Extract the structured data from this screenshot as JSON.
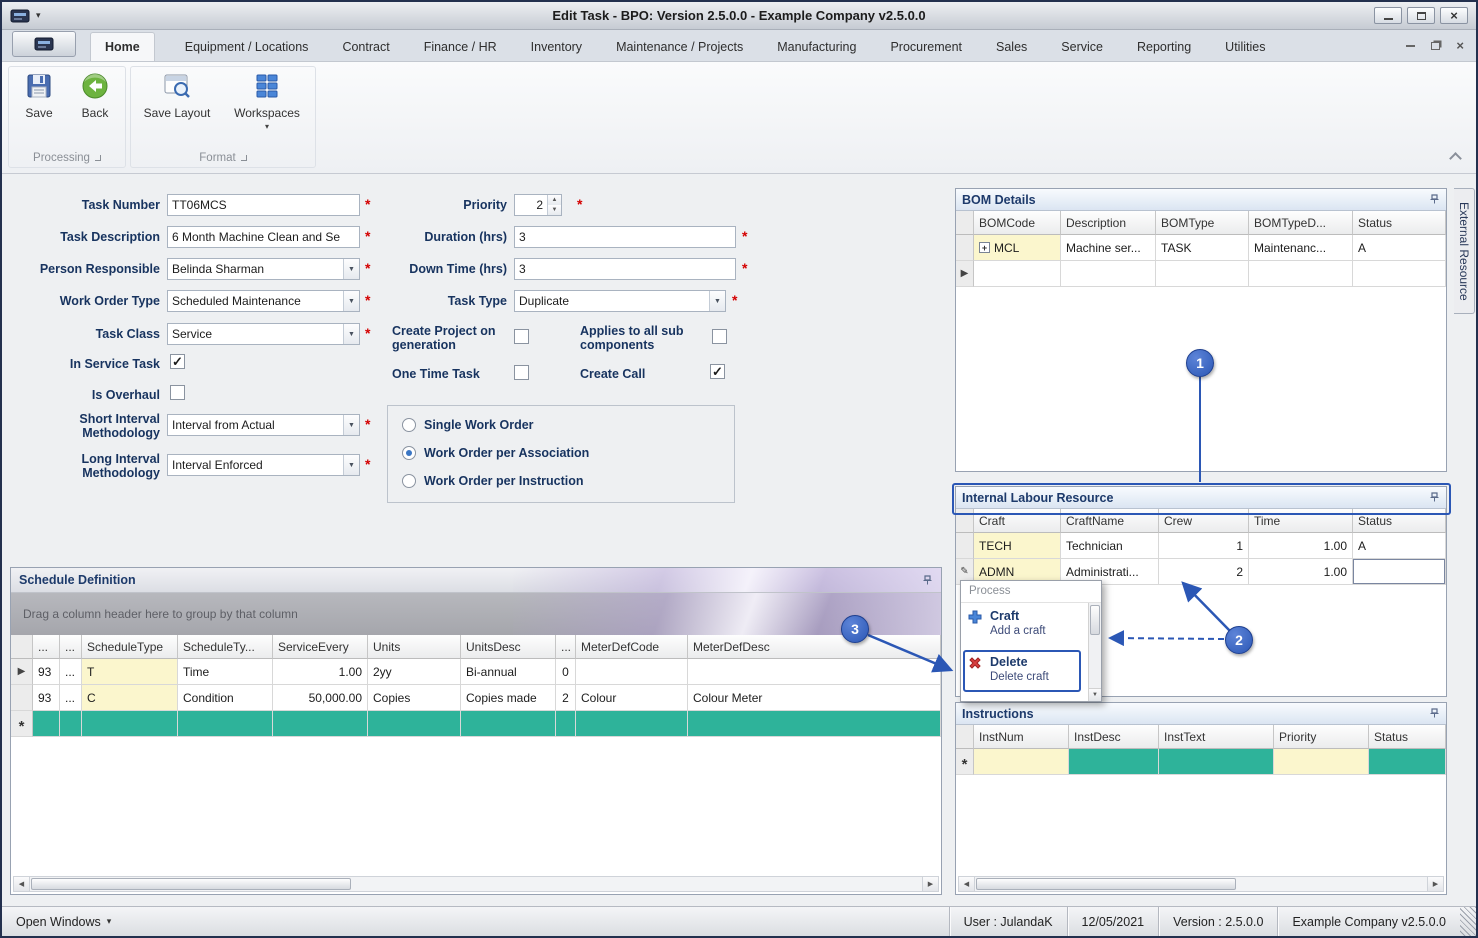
{
  "window": {
    "title": "Edit Task - BPO: Version 2.5.0.0 - Example Company v2.5.0.0"
  },
  "ribbon": {
    "tabs": [
      "Home",
      "Equipment / Locations",
      "Contract",
      "Finance / HR",
      "Inventory",
      "Maintenance / Projects",
      "Manufacturing",
      "Procurement",
      "Sales",
      "Service",
      "Reporting",
      "Utilities"
    ],
    "buttons": {
      "save": "Save",
      "back": "Back",
      "save_layout": "Save Layout",
      "workspaces": "Workspaces"
    },
    "groups": {
      "processing": "Processing",
      "format": "Format"
    }
  },
  "form": {
    "task_number": {
      "label": "Task Number",
      "value": "TT06MCS"
    },
    "task_description": {
      "label": "Task Description",
      "value": "6 Month Machine Clean and Se"
    },
    "person_responsible": {
      "label": "Person Responsible",
      "value": "Belinda Sharman"
    },
    "work_order_type": {
      "label": "Work Order Type",
      "value": "Scheduled Maintenance"
    },
    "task_class": {
      "label": "Task Class",
      "value": "Service"
    },
    "in_service_task": {
      "label": "In Service Task",
      "checked": true
    },
    "is_overhaul": {
      "label": "Is Overhaul",
      "checked": false
    },
    "short_interval_methodology": {
      "label": "Short Interval Methodology",
      "value": "Interval from Actual"
    },
    "long_interval_methodology": {
      "label": "Long Interval Methodology",
      "value": "Interval Enforced"
    },
    "priority": {
      "label": "Priority",
      "value": "2"
    },
    "duration_hrs": {
      "label": "Duration (hrs)",
      "value": "3"
    },
    "down_time_hrs": {
      "label": "Down Time (hrs)",
      "value": "3"
    },
    "task_type": {
      "label": "Task Type",
      "value": "Duplicate"
    },
    "create_project": {
      "label": "Create Project on generation",
      "checked": false
    },
    "applies_all_sub": {
      "label": "Applies to all sub components",
      "checked": false
    },
    "one_time_task": {
      "label": "One Time Task",
      "checked": false
    },
    "create_call": {
      "label": "Create Call",
      "checked": true
    },
    "work_order_options": [
      {
        "label": "Single Work Order",
        "selected": false
      },
      {
        "label": "Work Order per Association",
        "selected": true
      },
      {
        "label": "Work Order per Instruction",
        "selected": false
      }
    ]
  },
  "bom_details": {
    "title": "BOM Details",
    "columns": [
      "BOMCode",
      "Description",
      "BOMType",
      "BOMTypeD...",
      "Status"
    ],
    "rows": [
      [
        "MCL",
        "Machine ser...",
        "TASK",
        "Maintenanc...",
        "A"
      ]
    ]
  },
  "internal_labour": {
    "title": "Internal Labour Resource",
    "columns": [
      "Craft",
      "CraftName",
      "Crew",
      "Time",
      "Status"
    ],
    "rows": [
      [
        "TECH",
        "Technician",
        "1",
        "1.00",
        "A"
      ],
      [
        "ADMN",
        "Administrati...",
        "2",
        "1.00",
        ""
      ]
    ]
  },
  "instructions": {
    "title": "Instructions",
    "columns": [
      "InstNum",
      "InstDesc",
      "InstText",
      "Priority",
      "Status"
    ]
  },
  "schedule": {
    "title": "Schedule Definition",
    "group_hint": "Drag a column header here to group by that column",
    "columns": [
      "...",
      "...",
      "ScheduleType",
      "ScheduleTy...",
      "ServiceEvery",
      "Units",
      "UnitsDesc",
      "...",
      "MeterDefCode",
      "MeterDefDesc"
    ],
    "rows": [
      [
        "93",
        "...",
        "T",
        "Time",
        "1.00",
        "2yy",
        "Bi-annual",
        "0",
        "",
        ""
      ],
      [
        "93",
        "...",
        "C",
        "Condition",
        "50,000.00",
        "Copies",
        "Copies made",
        "2",
        "Colour",
        "Colour Meter"
      ]
    ]
  },
  "context_menu": {
    "title": "Process",
    "items": [
      {
        "label": "Craft",
        "desc": "Add a craft"
      },
      {
        "label": "Delete",
        "desc": "Delete craft"
      }
    ]
  },
  "side_tab": {
    "label": "External Resource"
  },
  "callouts": {
    "c1": "1",
    "c2": "2",
    "c3": "3"
  },
  "status_bar": {
    "open_windows": "Open Windows",
    "user": "User : JulandaK",
    "date": "12/05/2021",
    "version": "Version : 2.5.0.0",
    "company": "Example Company v2.5.0.0"
  },
  "glyphs": {
    "caret_down": "▾",
    "dropdown_arrow": "▼",
    "spinner_up": "▲",
    "spinner_down": "▼",
    "scroll_left": "◀",
    "scroll_right": "▶",
    "row_arrow": "▶",
    "check": "✓",
    "plus": "+",
    "asterisk": "*",
    "new_row": "*",
    "edit": "✎",
    "close": "×"
  },
  "colors": {
    "accent_blue": "#2b57b5",
    "teal": "#2eb39a",
    "yellow": "#fbf6cd",
    "required": "#d40000"
  }
}
